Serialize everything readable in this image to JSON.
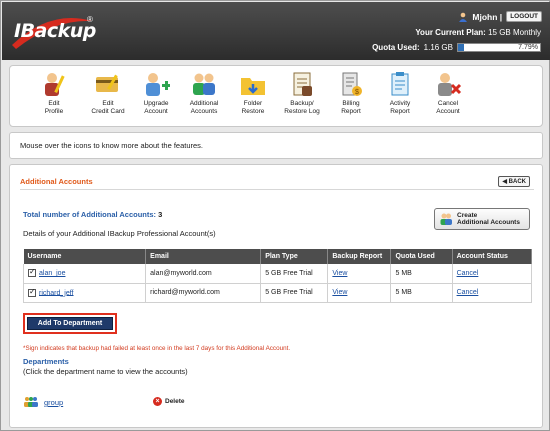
{
  "header": {
    "logo": "IBackup",
    "logo_mark": "®",
    "username": "Mjohn |",
    "logout_label": "LOGOUT",
    "plan_label": "Your Current Plan:",
    "plan_value": "15 GB Monthly",
    "quota_label": "Quota Used:",
    "quota_value": "1.16 GB",
    "quota_percent_label": "7.79%",
    "quota_fraction": 0.0779
  },
  "toolbar": {
    "items": [
      {
        "l1": "Edit",
        "l2": "Profile",
        "icon": "edit-profile-icon"
      },
      {
        "l1": "Edit",
        "l2": "Credit Card",
        "icon": "credit-card-icon"
      },
      {
        "l1": "Upgrade",
        "l2": "Account",
        "icon": "upgrade-account-icon"
      },
      {
        "l1": "Additional",
        "l2": "Accounts",
        "icon": "additional-accounts-icon"
      },
      {
        "l1": "Folder",
        "l2": "Restore",
        "icon": "folder-restore-icon"
      },
      {
        "l1": "Backup/",
        "l2": "Restore Log",
        "icon": "backup-log-icon"
      },
      {
        "l1": "Billing",
        "l2": "Report",
        "icon": "billing-report-icon"
      },
      {
        "l1": "Activity",
        "l2": "Report",
        "icon": "activity-report-icon"
      },
      {
        "l1": "Cancel",
        "l2": "Account",
        "icon": "cancel-account-icon"
      }
    ]
  },
  "info": {
    "text": "Mouse over the icons to know more about the features."
  },
  "panel": {
    "title": "Additional Accounts",
    "back_label": "◀ BACK",
    "total_label": "Total number of Additional Accounts:",
    "total_value": "3",
    "details": "Details of your Additional IBackup Professional Account(s)",
    "create_l1": "Create",
    "create_l2": "Additional Accounts",
    "columns": [
      "Username",
      "Email",
      "Plan Type",
      "Backup Report",
      "Quota Used",
      "Account Status"
    ],
    "rows": [
      {
        "username": "alan_joe",
        "email": "alan@myworld.com",
        "plan": "5 GB Free Trial",
        "report": "View",
        "quota": "5 MB",
        "status": "Cancel"
      },
      {
        "username": "richard_jeff",
        "email": "richard@myworld.com",
        "plan": "5 GB Free Trial",
        "report": "View",
        "quota": "5 MB",
        "status": "Cancel"
      }
    ],
    "add_dept_label": "Add To Department",
    "note": "*Sign indicates that backup had failed at least once in the last 7 days for this Additional Account.",
    "dept_title": "Departments",
    "dept_sub": "(Click the department name to view the accounts)",
    "dept_name": "group",
    "delete_label": "Delete"
  }
}
